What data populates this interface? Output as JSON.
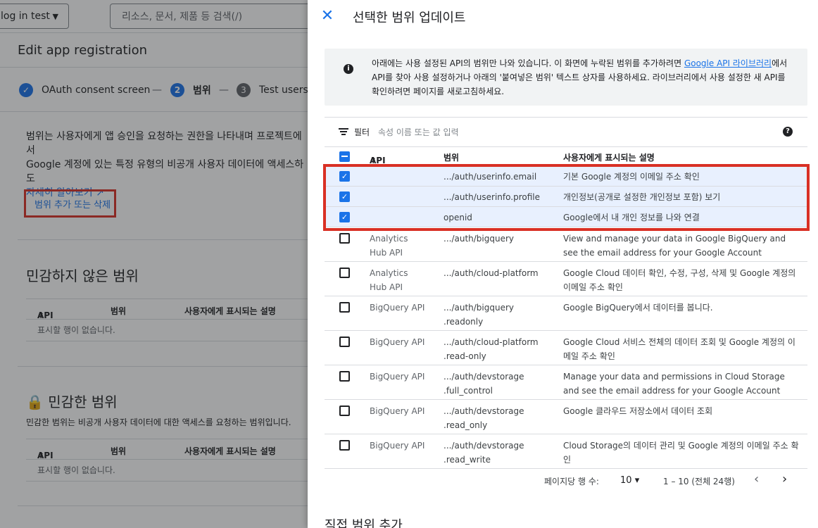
{
  "background": {
    "project_label": "log in test",
    "search_placeholder": "리소스, 문서, 제품 등 검색(/)",
    "page_title": "Edit app registration",
    "steps": [
      {
        "num": "✓",
        "label": "OAuth consent screen"
      },
      {
        "num": "2",
        "label": "범위"
      },
      {
        "num": "3",
        "label": "Test users"
      }
    ],
    "description_line1": "범위는 사용자에게 앱 승인을 요청하는 권한을 나타내며 프로젝트에서",
    "description_line2": "Google 계정에 있는 특정 유형의 비공개 사용자 데이터에 액세스하도",
    "learn_more": "자세히 알아보기",
    "add_remove_button": "범위 추가 또는 삭제",
    "non_sensitive_title": "민감하지 않은 범위",
    "sensitive_title": "민감한 범위",
    "sensitive_desc": "민감한 범위는 비공개 사용자 데이터에 대한 액세스를 요청하는 범위입니다.",
    "table_headers": {
      "api": "API",
      "scope": "범위",
      "desc": "사용자에게 표시되는 설명"
    },
    "empty_text": "표시할 행이 없습니다."
  },
  "panel": {
    "title": "선택한 범위 업데이트",
    "info_prefix": "아래에는 사용 설정된 API의 범위만 나와 있습니다. 이 화면에 누락된 범위를 추가하려면 ",
    "info_link": "Google API 라이브러리",
    "info_suffix": "에서 API를 찾아 사용 설정하거나 아래의 '붙여넣은 범위' 텍스트 상자를 사용하세요. 라이브러리에서 사용 설정한 새 API를 확인하려면 페이지를 새로고침하세요.",
    "filter_label": "필터",
    "filter_placeholder": "속성 이름 또는 값 입력",
    "headers": {
      "api": "API",
      "scope": "범위",
      "desc": "사용자에게 표시되는 설명"
    },
    "selected_rows": [
      {
        "api": "",
        "scope": ".../auth/userinfo.email",
        "desc": "기본 Google 계정의 이메일 주소 확인"
      },
      {
        "api": "",
        "scope": ".../auth/userinfo.profile",
        "desc": "개인정보(공개로 설정한 개인정보 포함) 보기"
      },
      {
        "api": "",
        "scope": "openid",
        "desc": "Google에서 내 개인 정보를 나와 연결"
      }
    ],
    "rows": [
      {
        "api": "Analytics Hub API",
        "scope": ".../auth/bigquery",
        "desc": "View and manage your data in Google BigQuery and see the email address for your Google Account"
      },
      {
        "api": "Analytics Hub API",
        "scope": ".../auth/cloud-platform",
        "desc": "Google Cloud 데이터 확인, 수정, 구성, 삭제 및 Google 계정의 이메일 주소 확인"
      },
      {
        "api": "BigQuery API",
        "scope": ".../auth/bigquery .readonly",
        "desc": "Google BigQuery에서 데이터를 봅니다."
      },
      {
        "api": "BigQuery API",
        "scope": ".../auth/cloud-platform .read-only",
        "desc": "Google Cloud 서비스 전체의 데이터 조회 및 Google 계정의 이메일 주소 확인"
      },
      {
        "api": "BigQuery API",
        "scope": ".../auth/devstorage .full_control",
        "desc": "Manage your data and permissions in Cloud Storage and see the email address for your Google Account"
      },
      {
        "api": "BigQuery API",
        "scope": ".../auth/devstorage .read_only",
        "desc": "Google 클라우드 저장소에서 데이터 조회"
      },
      {
        "api": "BigQuery API",
        "scope": ".../auth/devstorage .read_write",
        "desc": "Cloud Storage의 데이터 관리 및 Google 계정의 이메일 주소 확인"
      }
    ],
    "pager": {
      "rows_per_page_label": "페이지당 행 수:",
      "rows_per_page": "10",
      "range": "1 – 10 (전체 24행)"
    },
    "manual_section_title": "직접 범위 추가"
  }
}
